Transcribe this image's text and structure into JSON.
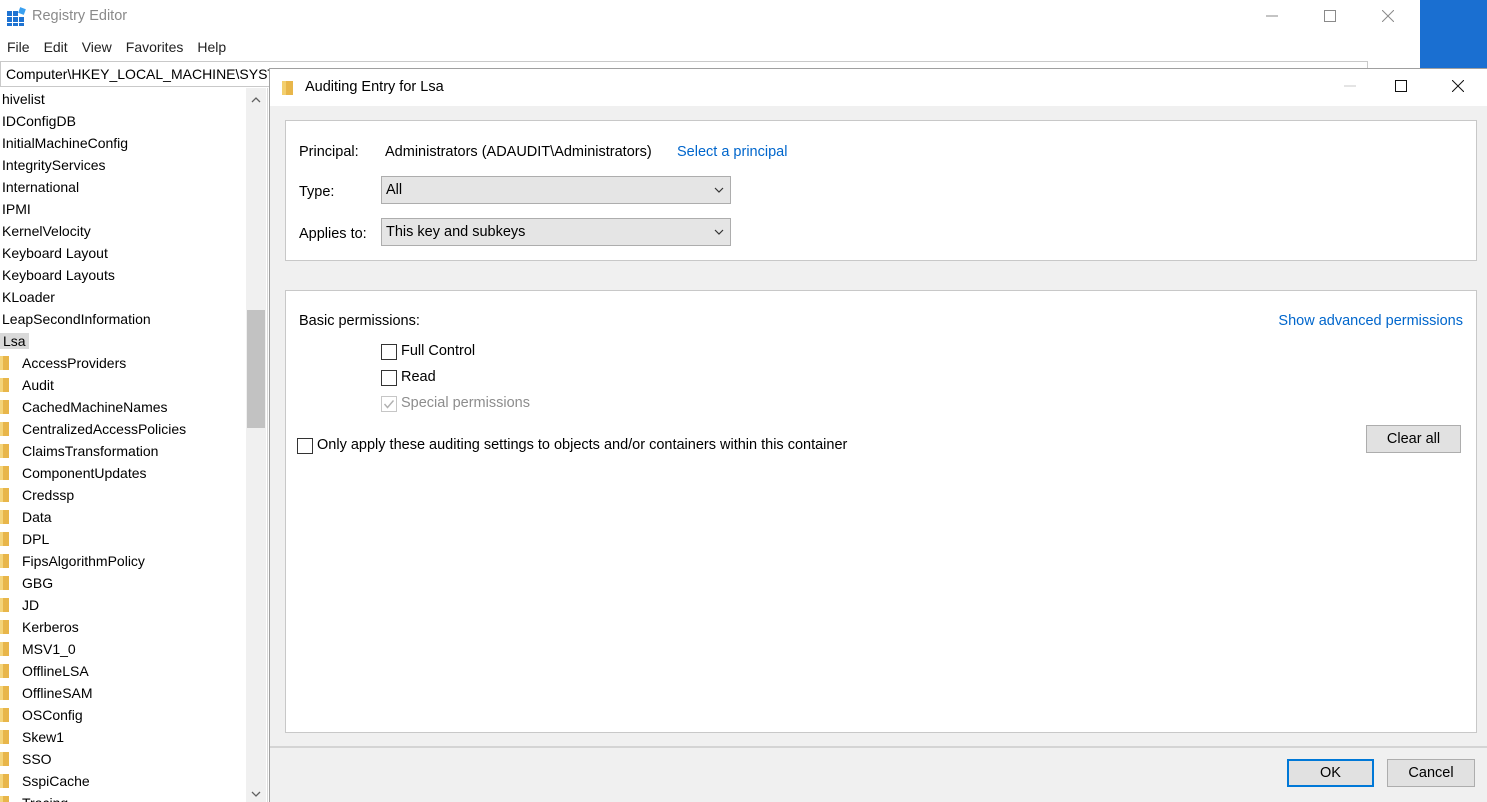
{
  "registry": {
    "title": "Registry Editor",
    "menu": [
      "File",
      "Edit",
      "View",
      "Favorites",
      "Help"
    ],
    "address": "Computer\\HKEY_LOCAL_MACHINE\\SYST",
    "tree_items": [
      {
        "label": "hivelist",
        "folder": false
      },
      {
        "label": "IDConfigDB",
        "folder": false
      },
      {
        "label": "InitialMachineConfig",
        "folder": false
      },
      {
        "label": "IntegrityServices",
        "folder": false
      },
      {
        "label": "International",
        "folder": false
      },
      {
        "label": "IPMI",
        "folder": false
      },
      {
        "label": "KernelVelocity",
        "folder": false
      },
      {
        "label": "Keyboard Layout",
        "folder": false
      },
      {
        "label": "Keyboard Layouts",
        "folder": false
      },
      {
        "label": "KLoader",
        "folder": false
      },
      {
        "label": "LeapSecondInformation",
        "folder": false
      },
      {
        "label": "Lsa",
        "folder": false,
        "selected": true
      },
      {
        "label": "AccessProviders",
        "folder": true
      },
      {
        "label": "Audit",
        "folder": true
      },
      {
        "label": "CachedMachineNames",
        "folder": true
      },
      {
        "label": "CentralizedAccessPolicies",
        "folder": true
      },
      {
        "label": "ClaimsTransformation",
        "folder": true
      },
      {
        "label": "ComponentUpdates",
        "folder": true
      },
      {
        "label": "Credssp",
        "folder": true
      },
      {
        "label": "Data",
        "folder": true
      },
      {
        "label": "DPL",
        "folder": true
      },
      {
        "label": "FipsAlgorithmPolicy",
        "folder": true
      },
      {
        "label": "GBG",
        "folder": true
      },
      {
        "label": "JD",
        "folder": true
      },
      {
        "label": "Kerberos",
        "folder": true
      },
      {
        "label": "MSV1_0",
        "folder": true
      },
      {
        "label": "OfflineLSA",
        "folder": true
      },
      {
        "label": "OfflineSAM",
        "folder": true
      },
      {
        "label": "OSConfig",
        "folder": true
      },
      {
        "label": "Skew1",
        "folder": true
      },
      {
        "label": "SSO",
        "folder": true
      },
      {
        "label": "SspiCache",
        "folder": true
      },
      {
        "label": "Tracing",
        "folder": true
      }
    ]
  },
  "dialog": {
    "title": "Auditing Entry for Lsa",
    "principal_label": "Principal:",
    "principal_value": "Administrators (ADAUDIT\\Administrators)",
    "select_principal_link": "Select a principal",
    "type_label": "Type:",
    "type_value": "All",
    "applies_label": "Applies to:",
    "applies_value": "This key and subkeys",
    "basic_permissions_label": "Basic permissions:",
    "show_advanced_link": "Show advanced permissions",
    "permissions": [
      {
        "label": "Full Control",
        "checked": false,
        "disabled": false
      },
      {
        "label": "Read",
        "checked": false,
        "disabled": false
      },
      {
        "label": "Special permissions",
        "checked": true,
        "disabled": true
      }
    ],
    "only_apply_label": "Only apply these auditing settings to objects and/or containers within this container",
    "clear_all_label": "Clear all",
    "ok_label": "OK",
    "cancel_label": "Cancel"
  },
  "colors": {
    "accent": "#0078d7",
    "link": "#0066cc",
    "desktop_blue": "#1a6fd1",
    "folder_yellow": "#e8b64a"
  }
}
